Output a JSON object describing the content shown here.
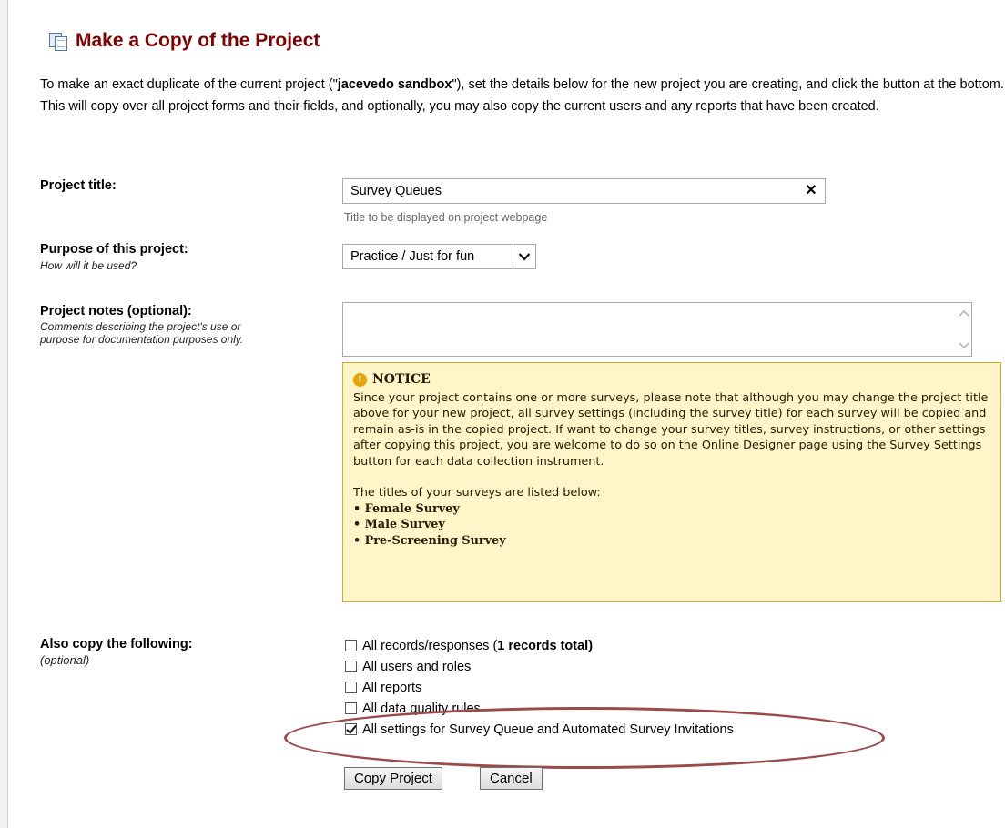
{
  "page": {
    "title": "Make a Copy of the Project",
    "intro_part1": "To make an exact duplicate of the current project (\"",
    "intro_project_name": "jacevedo sandbox",
    "intro_part2": "\"), set the details below for the new project you are creating, and click the button at the bottom. This will copy over all project forms and their fields, and optionally, you may also copy the current users and any reports that have been created."
  },
  "form": {
    "project_title_label": "Project title:",
    "project_title_value": "Survey Queues",
    "project_title_clear": "✕",
    "project_title_hint": "Title to be displayed on project webpage",
    "purpose_label": "Purpose of this project:",
    "purpose_sublabel": "How will it be used?",
    "purpose_value": "Practice / Just for fun",
    "notes_label": "Project notes (optional):",
    "notes_sublabel_1": "Comments describing the project's use or",
    "notes_sublabel_2": "purpose for documentation purposes only.",
    "notes_value": ""
  },
  "notice": {
    "title": "NOTICE",
    "body": "Since your project contains one or more surveys, please note that although you may change the project title above for your new project, all survey settings (including the survey title) for each survey will be copied and remain as-is in the copied project. If want to change your survey titles, survey instructions, or other settings after copying this project, you are welcome to do so on the Online Designer page using the Survey Settings button for each data collection instrument.",
    "surveys_heading": "The titles of your surveys are listed below:",
    "surveys": [
      "• Female Survey",
      "• Male Survey",
      "• Pre-Screening Survey"
    ]
  },
  "copy_options": {
    "label": "Also copy the following:",
    "sublabel": "(optional)",
    "records_label": "All records/responses (",
    "records_count": "1 records total)",
    "users_label": "All users and roles",
    "reports_label": "All reports",
    "dq_label": "All data quality rules",
    "survey_queue_label": "All settings for Survey Queue and Automated Survey Invitations",
    "records_checked": false,
    "users_checked": false,
    "reports_checked": false,
    "dq_checked": false,
    "survey_queue_checked": true
  },
  "buttons": {
    "copy": "Copy Project",
    "cancel": "Cancel"
  },
  "colors": {
    "title": "#800000",
    "notice_bg": "#fef5c8",
    "notice_border": "#d4ac33",
    "highlight_ellipse": "#9a4a4a"
  },
  "icons": {
    "title_icon": "copy-icon",
    "notice_icon": "warning-icon",
    "select_icon": "chevron-down-icon"
  }
}
